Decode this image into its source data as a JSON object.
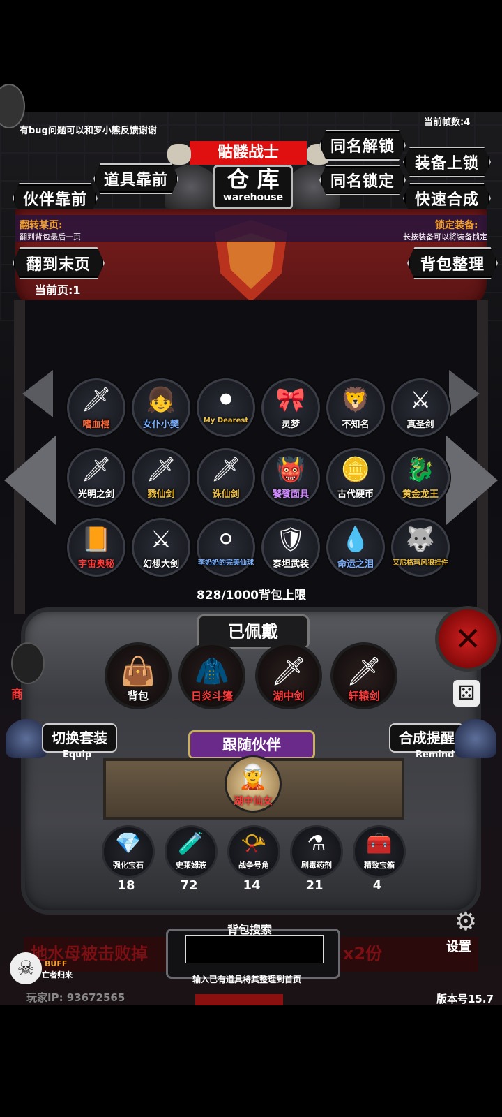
{
  "header": {
    "feedback_notice": "有bug问题可以和罗小熊反馈谢谢",
    "frame_count": "当前帧数:4",
    "title_tag": "骷髅战士",
    "title": "仓 库",
    "title_en": "warehouse"
  },
  "buttons": {
    "unlock_same_name": "同名解锁",
    "lock_equipment": "装备上锁",
    "items_first": "道具靠前",
    "lock_same_name": "同名锁定",
    "partner_first": "伙伴靠前",
    "quick_synthesis": "快速合成",
    "go_last_page": "翻到末页",
    "sort_backpack": "背包整理",
    "switch_set": "切换套装",
    "switch_set_en": "Equip",
    "synthesis_remind": "合成提醒",
    "synthesis_remind_en": "Remind"
  },
  "hints": {
    "flip_page_title": "翻转某页:",
    "flip_page_desc": "翻到背包最后一页",
    "lock_equip_title": "锁定装备:",
    "lock_equip_desc": "长按装备可以将装备锁定",
    "current_page": "当前页:1"
  },
  "warehouse_items": [
    {
      "name": "嗜血棍",
      "icon": "staff-icon",
      "glyph": "🗡",
      "color": "#ff6a3a"
    },
    {
      "name": "女仆小樊",
      "icon": "maid-icon",
      "glyph": "👧",
      "color": "#7ab0ff"
    },
    {
      "name": "My Dearest",
      "icon": "orb-icon",
      "glyph": "⚫",
      "color": "#f0c040"
    },
    {
      "name": "灵梦",
      "icon": "shrine-maiden-icon",
      "glyph": "🎀",
      "color": "#ffffff"
    },
    {
      "name": "不知名",
      "icon": "beast-icon",
      "glyph": "🦁",
      "color": "#ffffff"
    },
    {
      "name": "真圣剑",
      "icon": "holy-sword-icon",
      "glyph": "⚔",
      "color": "#ffffff"
    },
    {
      "name": "光明之剑",
      "icon": "light-sword-icon",
      "glyph": "🗡",
      "color": "#ffffff"
    },
    {
      "name": "戮仙剑",
      "icon": "slay-sword-icon",
      "glyph": "🗡",
      "color": "#f0c040"
    },
    {
      "name": "诛仙剑",
      "icon": "zhuxian-sword-icon",
      "glyph": "🗡",
      "color": "#f0c040"
    },
    {
      "name": "饕餮面具",
      "icon": "mask-icon",
      "glyph": "👹",
      "color": "#d18cff"
    },
    {
      "name": "古代硬币",
      "icon": "coin-icon",
      "glyph": "🪙",
      "color": "#ffffff"
    },
    {
      "name": "黄金龙王",
      "icon": "dragon-icon",
      "glyph": "🐉",
      "color": "#f0c040"
    },
    {
      "name": "宇宙奥秘",
      "icon": "book-icon",
      "glyph": "📙",
      "color": "#ff3a3a"
    },
    {
      "name": "幻想大剑",
      "icon": "great-sword-icon",
      "glyph": "⚔",
      "color": "#ffffff"
    },
    {
      "name": "李奶奶的完美仙球",
      "icon": "ball-icon",
      "glyph": "⚪",
      "color": "#7ab0ff"
    },
    {
      "name": "泰坦武装",
      "icon": "armor-icon",
      "glyph": "🛡",
      "color": "#ffffff"
    },
    {
      "name": "命运之泪",
      "icon": "tear-icon",
      "glyph": "💧",
      "color": "#7ab0ff"
    },
    {
      "name": "艾尼格玛风狼挂件",
      "icon": "wolf-pendant-icon",
      "glyph": "🐺",
      "color": "#f0c040"
    }
  ],
  "capacity": "828/1000背包上限",
  "equipped": {
    "title": "已佩戴",
    "slots": [
      {
        "name": "背包",
        "icon": "bag-icon",
        "glyph": "👜",
        "color": "#ffffff"
      },
      {
        "name": "日炎斗篷",
        "icon": "cloak-icon",
        "glyph": "🧥",
        "color": "#ff3a3a"
      },
      {
        "name": "湖中剑",
        "icon": "lake-sword-icon",
        "glyph": "🗡",
        "color": "#ff3a3a"
      },
      {
        "name": "轩辕剑",
        "icon": "xuanyuan-sword-icon",
        "glyph": "🗡",
        "color": "#ff3a3a"
      }
    ]
  },
  "partner": {
    "title": "跟随伙伴",
    "name": "湖中仙女",
    "icon": "fairy-icon"
  },
  "consumables": [
    {
      "name": "强化宝石",
      "count": "18",
      "icon": "gem-icon",
      "glyph": "💎"
    },
    {
      "name": "史莱姆液",
      "count": "72",
      "icon": "potion-icon",
      "glyph": "🧪"
    },
    {
      "name": "战争号角",
      "count": "14",
      "icon": "horn-icon",
      "glyph": "📯"
    },
    {
      "name": "剧毒药剂",
      "count": "21",
      "icon": "poison-icon",
      "glyph": "⚗"
    },
    {
      "name": "精致宝箱",
      "count": "4",
      "icon": "chest-icon",
      "glyph": "🧰"
    }
  ],
  "search": {
    "title": "背包搜索",
    "hint": "输入已有道具将其整理到首页",
    "value": ""
  },
  "footer": {
    "ticker_left": "地水母被击败掉",
    "ticker_right": "x2份",
    "buff": "BUFF",
    "buff_sub": "亡者归来",
    "player_ip": "玩家IP:  93672565",
    "version": "版本号15.7",
    "settings": "设置",
    "shop": "商"
  },
  "colors": {
    "banner_red": "#7a1d1d",
    "title_tag_red": "#e01010",
    "partner_purple": "#6a2a8a"
  }
}
